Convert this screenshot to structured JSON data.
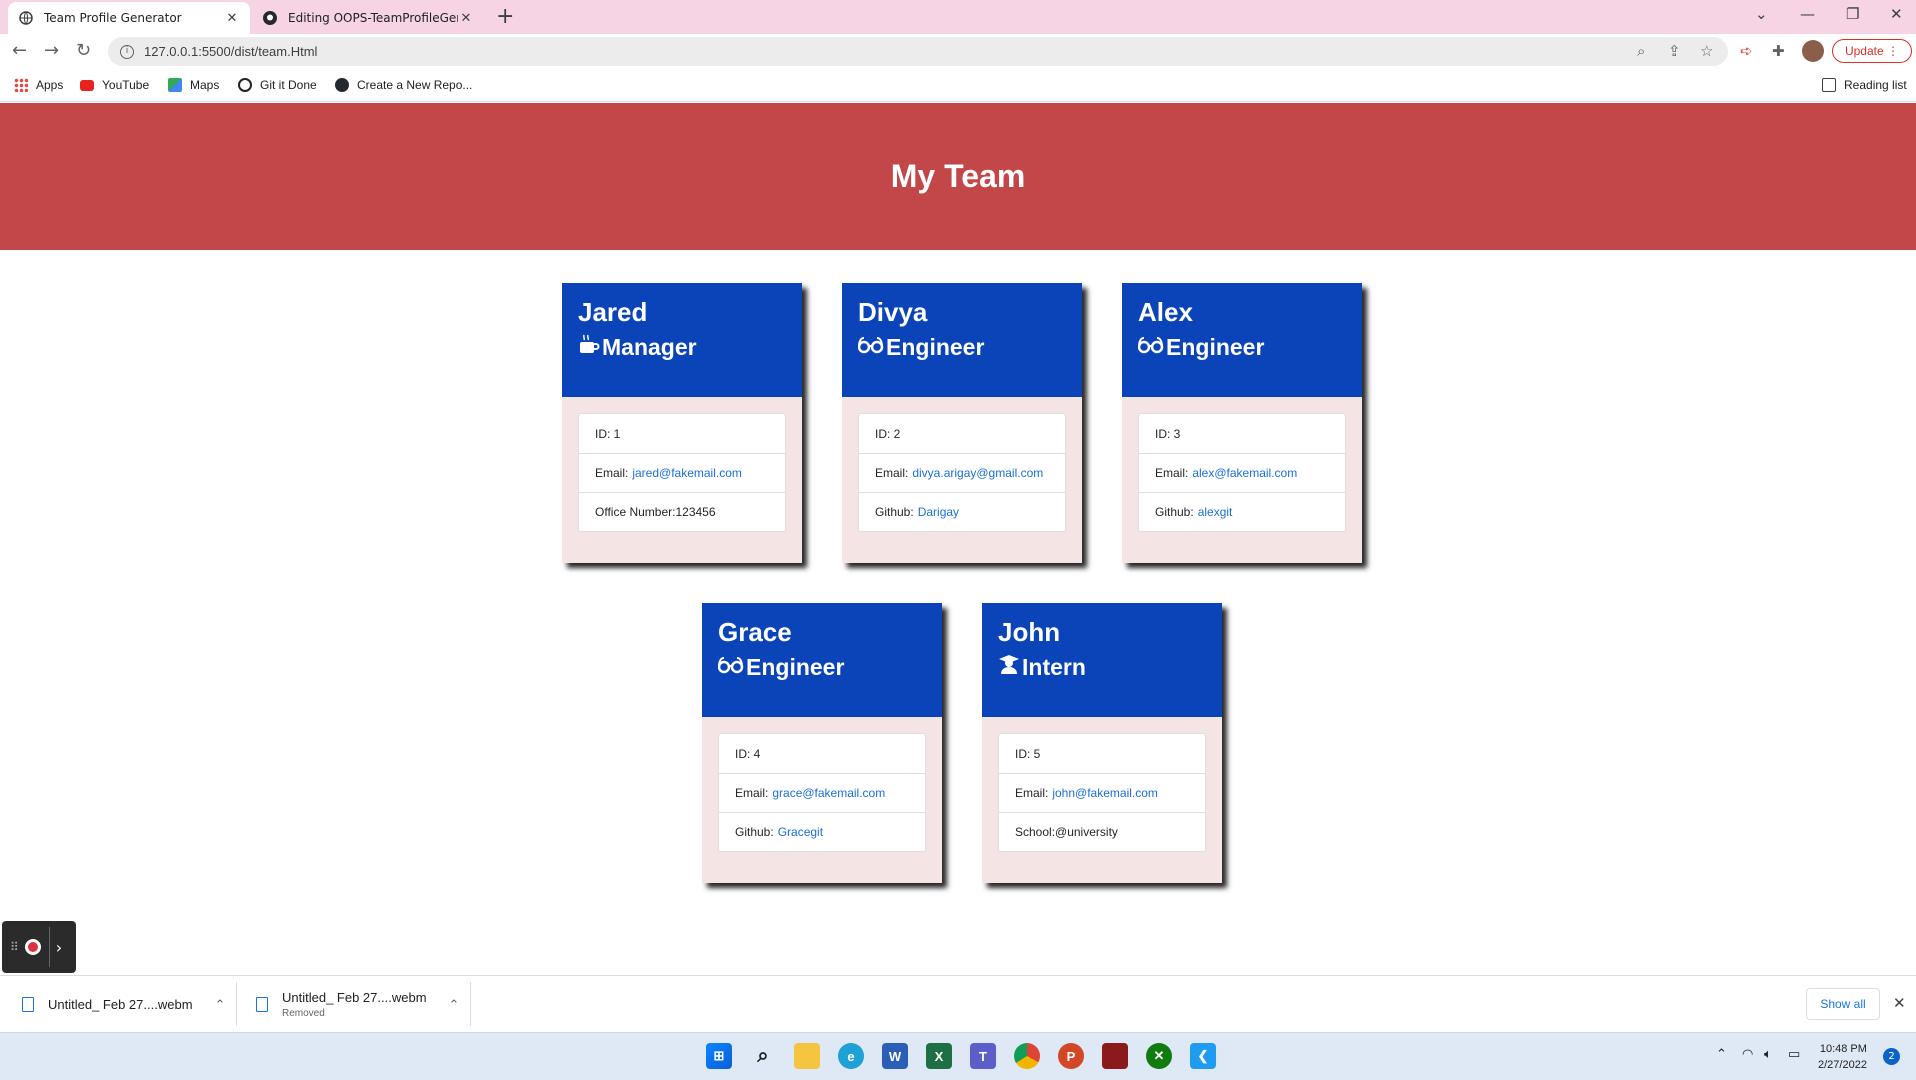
{
  "browser": {
    "tabs": [
      {
        "title": "Team Profile Generator",
        "active": true,
        "icon": "globe-icon"
      },
      {
        "title": "Editing OOPS-TeamProfileGenera",
        "active": false,
        "icon": "github-icon"
      }
    ],
    "address": "127.0.0.1:5500/dist/team.Html",
    "update_label": "Update",
    "bookmarks": [
      {
        "label": "Apps",
        "icon": "apps-grid-icon"
      },
      {
        "label": "YouTube",
        "icon": "youtube-icon"
      },
      {
        "label": "Maps",
        "icon": "maps-icon"
      },
      {
        "label": "Git it Done",
        "icon": "globe-icon"
      },
      {
        "label": "Create a New Repo...",
        "icon": "github-icon"
      }
    ],
    "reading_list": "Reading list"
  },
  "page": {
    "heading": "My Team",
    "employees": [
      {
        "name": "Jared",
        "role": "Manager",
        "icon": "coffee-mug-icon",
        "id": "ID: 1",
        "email_label": "Email:",
        "email": "jared@fakemail.com",
        "extra_label": "Office Number:",
        "extra": "123456",
        "extra_is_link": false
      },
      {
        "name": "Divya",
        "role": "Engineer",
        "icon": "glasses-icon",
        "id": "ID: 2",
        "email_label": "Email:",
        "email": "divya.arigay@gmail.com",
        "extra_label": "Github:",
        "extra": "Darigay",
        "extra_is_link": true
      },
      {
        "name": "Alex",
        "role": "Engineer",
        "icon": "glasses-icon",
        "id": "ID: 3",
        "email_label": "Email:",
        "email": "alex@fakemail.com",
        "extra_label": "Github:",
        "extra": "alexgit",
        "extra_is_link": true
      },
      {
        "name": "Grace",
        "role": "Engineer",
        "icon": "glasses-icon",
        "id": "ID: 4",
        "email_label": "Email:",
        "email": "grace@fakemail.com",
        "extra_label": "Github:",
        "extra": "Gracegit",
        "extra_is_link": true
      },
      {
        "name": "John",
        "role": "Intern",
        "icon": "graduate-icon",
        "id": "ID: 5",
        "email_label": "Email:",
        "email": "john@fakemail.com",
        "extra_label": "School:",
        "extra": "@university",
        "extra_is_link": false
      }
    ]
  },
  "downloads": {
    "items": [
      {
        "name": "Untitled_ Feb 27....webm",
        "status": ""
      },
      {
        "name": "Untitled_ Feb 27....webm",
        "status": "Removed"
      }
    ],
    "show_all": "Show all"
  },
  "taskbar": {
    "time": "10:48 PM",
    "date": "2/27/2022",
    "notifications": "2",
    "apps": [
      "windows-start-icon",
      "search-icon",
      "file-explorer-icon",
      "edge-icon",
      "word-icon",
      "excel-icon",
      "teams-icon",
      "chrome-icon",
      "powerpoint-icon",
      "app-icon",
      "xbox-icon",
      "vscode-icon"
    ]
  }
}
